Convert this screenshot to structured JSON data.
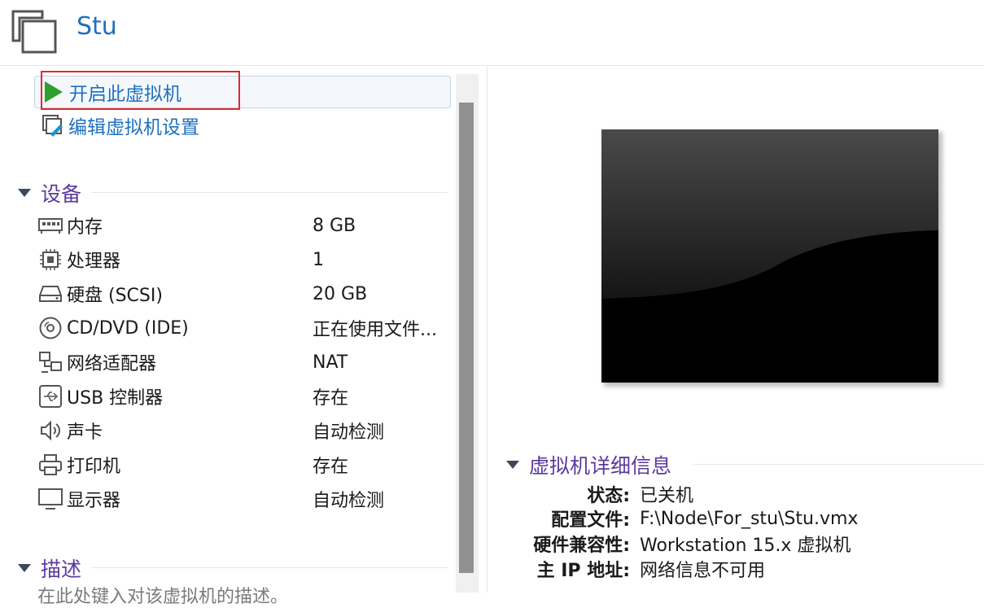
{
  "header": {
    "title": "Stu",
    "icon": "vm-window-icon"
  },
  "actions": {
    "start_label": "开启此虚拟机",
    "edit_label": "编辑虚拟机设置"
  },
  "devices": {
    "section_title": "设备",
    "items": [
      {
        "name": "内存",
        "value": "8 GB",
        "icon": "memory-icon"
      },
      {
        "name": "处理器",
        "value": "1",
        "icon": "processor-icon"
      },
      {
        "name": "硬盘 (SCSI)",
        "value": "20 GB",
        "icon": "harddisk-icon"
      },
      {
        "name": "CD/DVD (IDE)",
        "value": "正在使用文件...",
        "icon": "cd-dvd-icon"
      },
      {
        "name": "网络适配器",
        "value": "NAT",
        "icon": "network-adapter-icon"
      },
      {
        "name": "USB 控制器",
        "value": "存在",
        "icon": "usb-icon"
      },
      {
        "name": "声卡",
        "value": "自动检测",
        "icon": "speaker-icon"
      },
      {
        "name": "打印机",
        "value": "存在",
        "icon": "printer-icon"
      },
      {
        "name": "显示器",
        "value": "自动检测",
        "icon": "monitor-icon"
      }
    ]
  },
  "description": {
    "section_title": "描述",
    "placeholder": "在此处键入对该虚拟机的描述。"
  },
  "details": {
    "section_title": "虚拟机详细信息",
    "rows": [
      {
        "key": "状态:",
        "value": "已关机"
      },
      {
        "key": "配置文件:",
        "value": "F:\\Node\\For_stu\\Stu.vmx"
      },
      {
        "key": "硬件兼容性:",
        "value": "Workstation 15.x 虚拟机"
      },
      {
        "key": "主 IP 地址:",
        "value": "网络信息不可用"
      }
    ]
  },
  "colors": {
    "accent_blue": "#1f6fbf",
    "section_purple": "#5b3a9e",
    "highlight_red": "#e0282e",
    "play_green": "#2e9e2e"
  }
}
